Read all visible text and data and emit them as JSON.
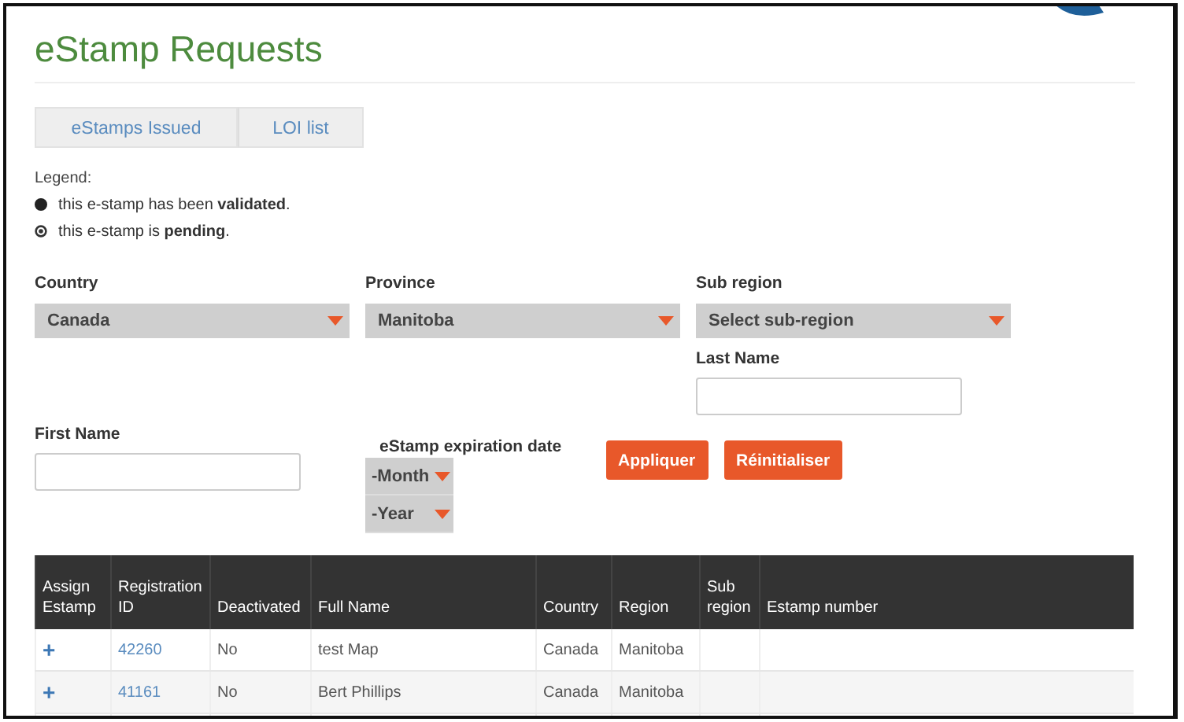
{
  "page": {
    "title": "eStamp Requests"
  },
  "tabs": [
    {
      "label": "eStamps Issued",
      "selected": false
    },
    {
      "label": "LOI list",
      "selected": false
    }
  ],
  "legend": {
    "title": "Legend:",
    "items": [
      {
        "kind": "validated",
        "text": "this e-stamp has been **validated**."
      },
      {
        "kind": "pending",
        "text": "this e-stamp is **pending**."
      }
    ]
  },
  "filters": {
    "country": {
      "label": "Country",
      "value": "Canada"
    },
    "province": {
      "label": "Province",
      "value": "Manitoba"
    },
    "sub_region": {
      "label": "Sub region",
      "value": "Select sub-region"
    },
    "last_name": {
      "label": "Last Name"
    },
    "first_name": {
      "label": "First Name"
    },
    "expiration": {
      "label": "eStamp expiration date",
      "month": "-Month",
      "year": "-Year"
    }
  },
  "buttons": [
    "Appliquer",
    "Réinitialiser"
  ],
  "table": {
    "columns": [
      "Assign Estamp",
      "Registration ID",
      "Deactivated",
      "Full Name",
      "Country",
      "Region",
      "Sub region",
      "Estamp number"
    ],
    "rows": [
      {
        "assign": "+",
        "registration_id": "42260",
        "deactivated": "No",
        "full_name": "test Map",
        "country": "Canada",
        "region": "Manitoba"
      },
      {
        "assign": "+",
        "registration_id": "41161",
        "deactivated": "No",
        "full_name": "Bert Phillips",
        "country": "Canada",
        "region": "Manitoba"
      }
    ]
  }
}
